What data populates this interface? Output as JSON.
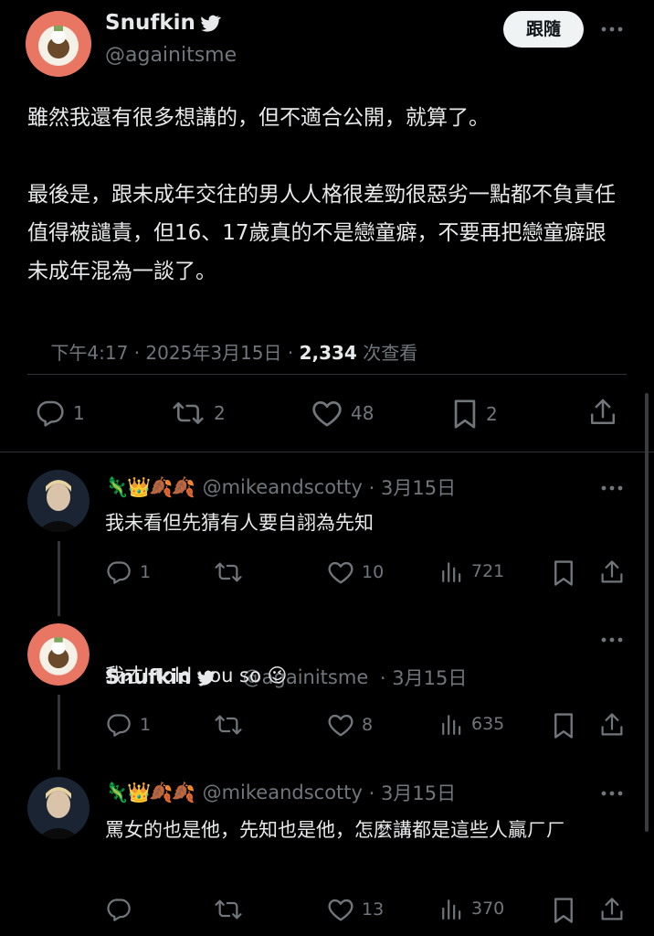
{
  "main_tweet": {
    "author_name": "Snufkin",
    "handle": "@againitsme",
    "follow_label": "跟隨",
    "paragraphs": [
      "雖然我還有很多想講的，但不適合公開，就算了。",
      "最後是，跟未成年交往的男人人格很差勁很惡劣一點都不負責任值得被譴責，但16、17歲真的不是戀童癖，不要再把戀童癖跟未成年混為一談了。"
    ],
    "meta_time": "下午4:17 · 2025年3月15日 · ",
    "views_count": "2,334",
    "views_label": " 次查看",
    "stats": {
      "replies": "1",
      "retweets": "2",
      "likes": "48",
      "bookmarks": "2"
    }
  },
  "replies": [
    {
      "emojis": "🦎👑🍂🍂",
      "author_name": "",
      "handle": "@mikeandscotty",
      "date": " · 3月15日",
      "text": "我未看但先猜有人要自詡為先知",
      "stats": {
        "replies": "1",
        "retweets": "",
        "likes": "10",
        "views": "721"
      }
    },
    {
      "emojis": "",
      "author_name": "Snufkin",
      "handle": "@againitsme",
      "date": " · 3月15日",
      "text": "我才I told you so 😉",
      "stats": {
        "replies": "1",
        "retweets": "",
        "likes": "8",
        "views": "635"
      }
    },
    {
      "emojis": "🦎👑🍂🍂",
      "author_name": "",
      "handle": "@mikeandscotty",
      "date": " · 3月15日",
      "text": "罵女的也是他，先知也是他，怎麼講都是這些人贏ㄏㄏ",
      "stats": {
        "replies": "",
        "retweets": "",
        "likes": "13",
        "views": "370"
      }
    }
  ],
  "colors": {
    "background": "#000000",
    "text": "#e7e9ea",
    "secondary": "#71767b",
    "divider": "#2f3336",
    "verified": "#e7e9ea",
    "follow_bg": "#eff3f4"
  },
  "icons": [
    "verified-badge-icon",
    "more-icon",
    "reply-icon",
    "retweet-icon",
    "like-icon",
    "bookmark-icon",
    "share-icon",
    "views-icon"
  ]
}
